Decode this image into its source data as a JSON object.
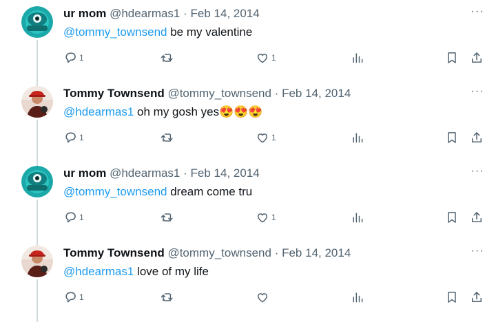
{
  "tweets": [
    {
      "author": "ur mom",
      "handle": "@hdearmas1",
      "dot": "·",
      "date": "Feb 14, 2014",
      "mention": "@tommy_townsend",
      "text": " be my valentine",
      "emoji": "",
      "reply_count": "1",
      "retweet_count": "",
      "like_count": "1",
      "more": "···",
      "avatar_color": "#1aa8a8"
    },
    {
      "author": "Tommy Townsend",
      "handle": "@tommy_townsend",
      "dot": "·",
      "date": "Feb 14, 2014",
      "mention": "@hdearmas1",
      "text": " oh my gosh yes",
      "emoji": "😍😍😍",
      "reply_count": "1",
      "retweet_count": "",
      "like_count": "1",
      "more": "···",
      "avatar_color": "#b5322a"
    },
    {
      "author": "ur mom",
      "handle": "@hdearmas1",
      "dot": "·",
      "date": "Feb 14, 2014",
      "mention": "@tommy_townsend",
      "text": " dream come tru",
      "emoji": "",
      "reply_count": "1",
      "retweet_count": "",
      "like_count": "1",
      "more": "···",
      "avatar_color": "#1aa8a8"
    },
    {
      "author": "Tommy Townsend",
      "handle": "@tommy_townsend",
      "dot": "·",
      "date": "Feb 14, 2014",
      "mention": "@hdearmas1",
      "text": " love of my life",
      "emoji": "",
      "reply_count": "1",
      "retweet_count": "",
      "like_count": "",
      "more": "···",
      "avatar_color": "#b5322a"
    }
  ],
  "colors": {
    "mention": "#1d9bf0",
    "secondary_text": "#536471",
    "primary_text": "#0f1419",
    "thread_line": "#cfd9de"
  },
  "icons": {
    "reply": "reply-icon",
    "retweet": "retweet-icon",
    "like": "heart-icon",
    "views": "views-icon",
    "bookmark": "bookmark-icon",
    "share": "share-icon",
    "more": "more-icon"
  }
}
